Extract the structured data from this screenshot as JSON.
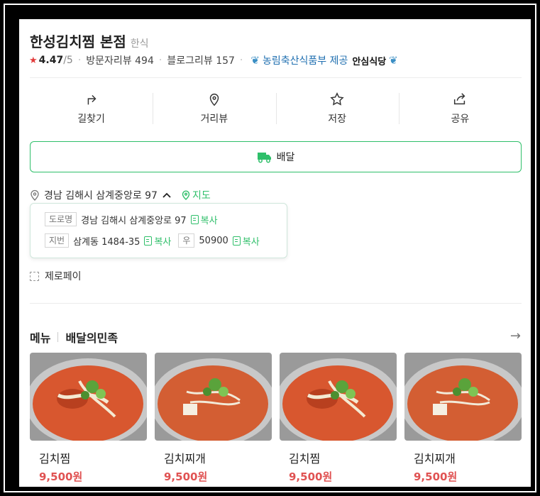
{
  "place": {
    "name": "한성김치찜 본점",
    "category": "한식",
    "rating": "4.47",
    "rating_max": "/5",
    "visitor_reviews_label": "방문자리뷰",
    "visitor_reviews_count": "494",
    "blog_reviews_label": "블로그리뷰",
    "blog_reviews_count": "157",
    "gov_label": "농림축산식품부 제공",
    "safe_label": "안심식당"
  },
  "actions": [
    {
      "label": "길찾기",
      "icon": "directions-icon"
    },
    {
      "label": "거리뷰",
      "icon": "location-pin-icon"
    },
    {
      "label": "저장",
      "icon": "star-icon"
    },
    {
      "label": "공유",
      "icon": "share-icon"
    }
  ],
  "delivery": {
    "label": "배달",
    "icon": "delivery-truck-icon"
  },
  "address": {
    "text": "경남 김해시 삼계중앙로 97",
    "map_label": "지도",
    "road_tag": "도로명",
    "road_value": "경남 김해시 삼계중앙로 97",
    "lot_tag": "지번",
    "lot_value": "삼계동 1484-35",
    "zip_tag": "우",
    "zip_value": "50900",
    "copy_label": "복사"
  },
  "zeropay": {
    "label": "제로페이"
  },
  "menu": {
    "title": "메뉴",
    "source": "배달의민족",
    "items": [
      {
        "name": "김치찜",
        "price": "9,500원"
      },
      {
        "name": "김치찌개",
        "price": "9,500원"
      },
      {
        "name": "김치찜",
        "price": "9,500원"
      },
      {
        "name": "김치찌개",
        "price": "9,500원"
      }
    ]
  },
  "colors": {
    "accent": "#2fbf6a",
    "price": "#e05252",
    "rating_star": "#e23b3b"
  }
}
